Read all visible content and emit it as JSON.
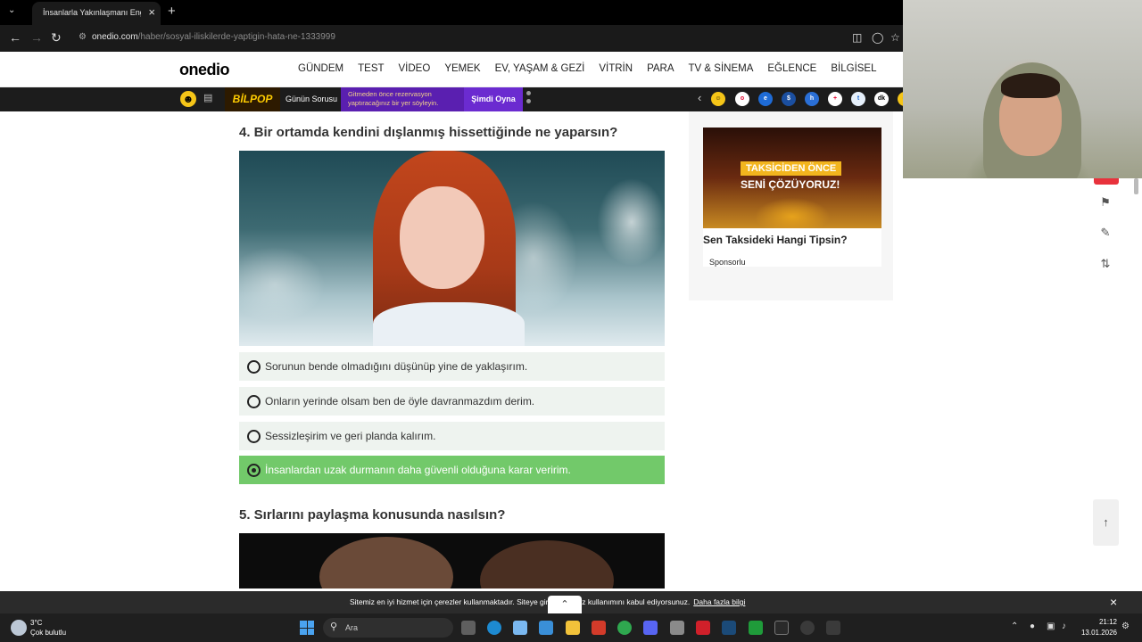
{
  "browser": {
    "tab_title": "İnsanlarla Yakınlaşmanı Engelleyen",
    "url_domain": "onedio.com",
    "url_path": "/haber/sosyal-iliskilerde-yaptigin-hata-ne-1333999"
  },
  "site": {
    "logo": "onedio",
    "nav": [
      "GÜNDEM",
      "TEST",
      "VİDEO",
      "YEMEK",
      "EV, YAŞAM & GEZİ",
      "VİTRİN",
      "PARA",
      "TV & SİNEMA",
      "EĞLENCE",
      "BİLGİSEL"
    ]
  },
  "promo": {
    "bilpop": "BİLPOP",
    "gunun_sorusu": "Günün Sorusu",
    "ad_text": "Gitmeden önce rezervasyon yaptıracağınız bir yer söyleyin.",
    "play_label": "Şimdi Oyna",
    "category_icons": [
      "emoji-icon",
      "onedio-icon",
      "ekonomi-icon",
      "dollar-icon",
      "haber-icon",
      "health-icon",
      "travel-icon",
      "dk-icon"
    ]
  },
  "quiz": {
    "question4": "4. Bir ortamda kendini dışlanmış hissettiğinde ne yaparsın?",
    "options": [
      {
        "label": "Sorunun bende olmadığını düşünüp yine de yaklaşırım.",
        "selected": false
      },
      {
        "label": "Onların yerinde olsam ben de öyle davranmazdım derim.",
        "selected": false
      },
      {
        "label": "Sessizleşirim ve geri planda kalırım.",
        "selected": false
      },
      {
        "label": "İnsanlardan uzak durmanın daha güvenli olduğuna karar veririm.",
        "selected": true
      }
    ],
    "question5": "5. Sırlarını paylaşma konusunda nasılsın?"
  },
  "sidebar_ad": {
    "badge_line1": "TAKSİCİDEN ÖNCE",
    "badge_line2": "SENİ ÇÖZÜYORUZ!",
    "title": "Sen Taksideki Hangi Tipsin?",
    "sponsor": "Sponsorlu"
  },
  "cookie": {
    "text": "Sitemiz en iyi hizmet için çerezler kullanmaktadır. Siteye gir",
    "text_end": "çerez kullanımını kabul ediyorsunuz.",
    "link": "Daha fazla bilgi"
  },
  "taskbar": {
    "temp": "3°C",
    "weather": "Çok bulutlu",
    "search_placeholder": "Ara",
    "time": "21:12",
    "date": "13.01.2026"
  },
  "colors": {
    "selected_option": "#72c96a",
    "option_bg": "#eef3ef",
    "promo_purple": "#6b2bd0"
  }
}
